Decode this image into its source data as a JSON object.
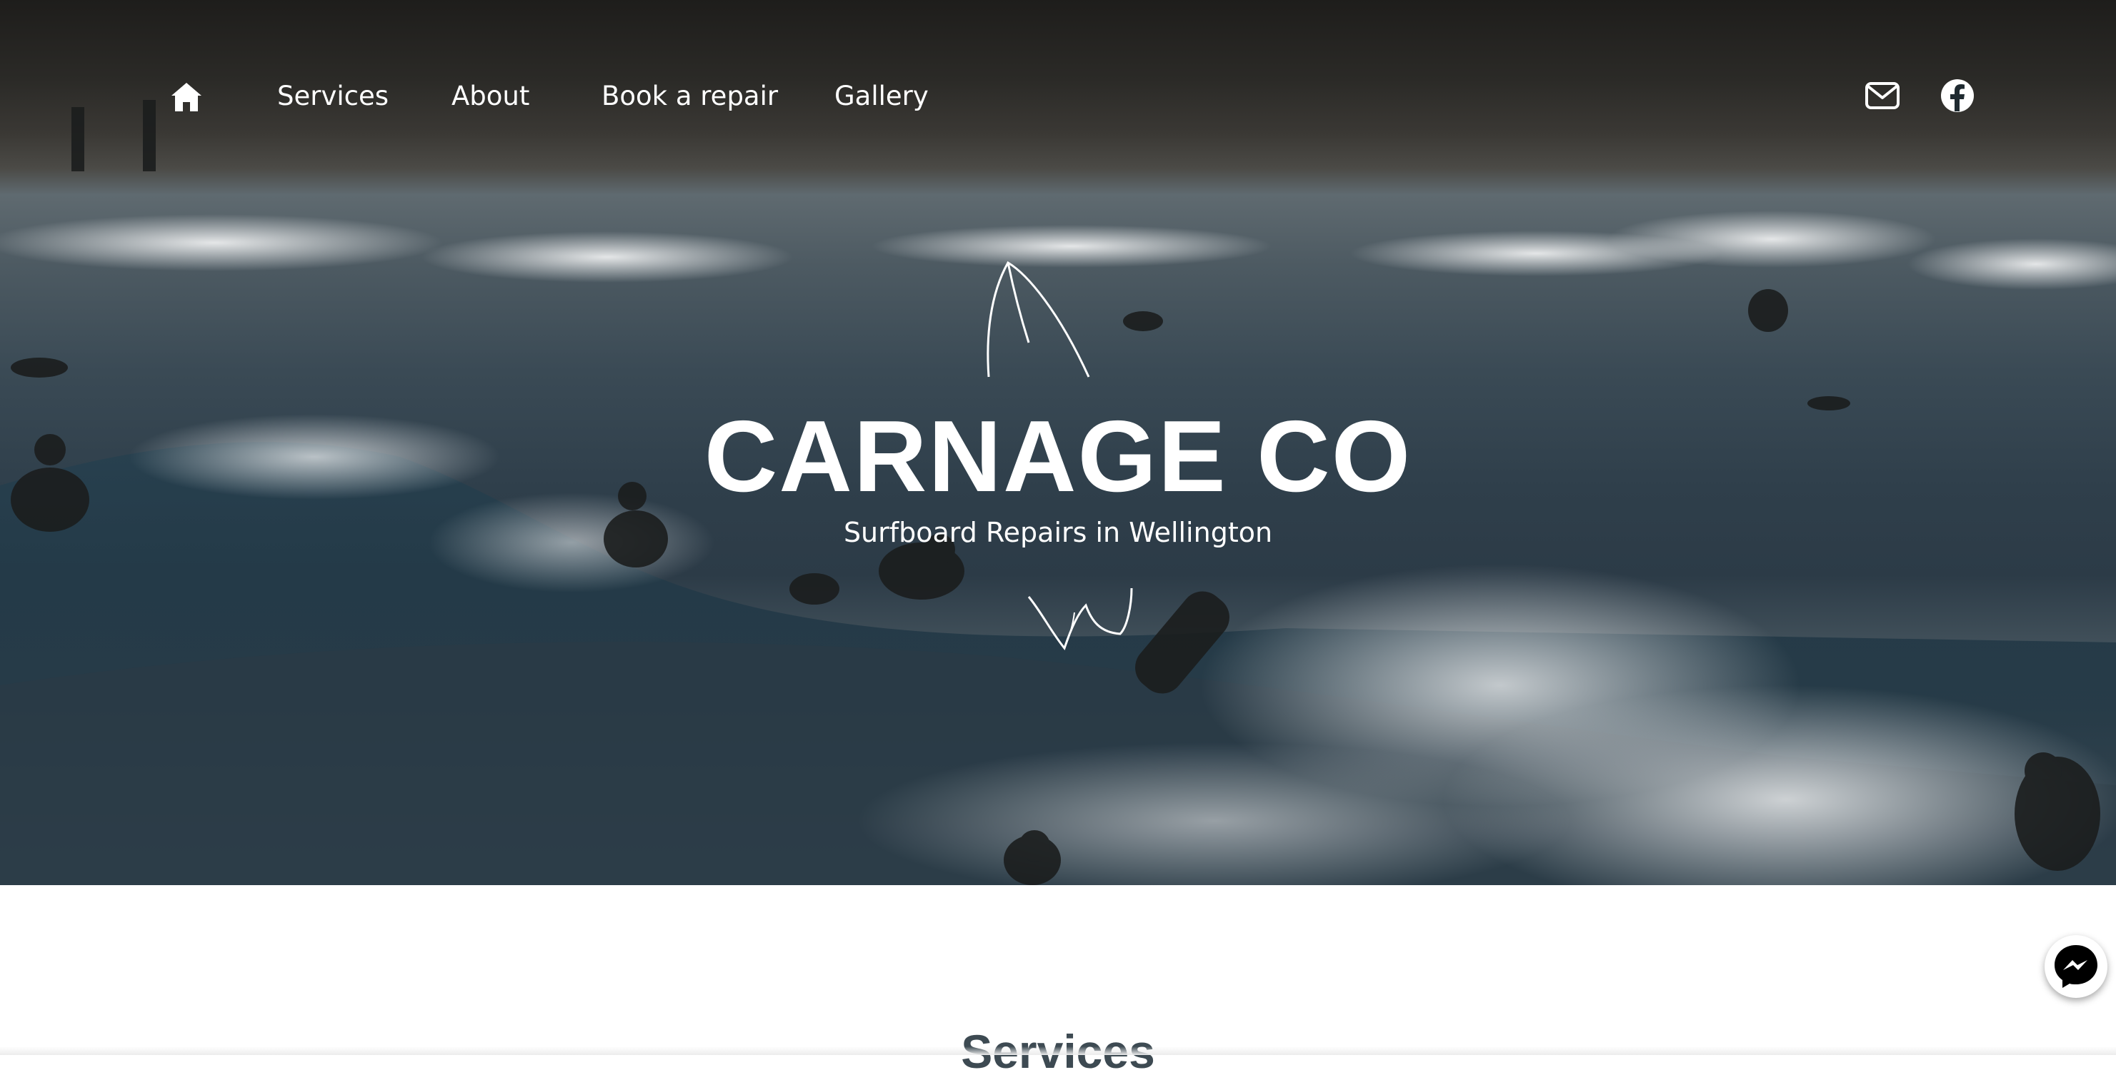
{
  "nav": {
    "home_icon": "home-icon",
    "links": [
      {
        "label": "Services"
      },
      {
        "label": "About"
      },
      {
        "label": "Book a repair"
      },
      {
        "label": "Gallery"
      }
    ],
    "social_icons": [
      "envelope-icon",
      "facebook-icon"
    ]
  },
  "hero": {
    "title": "CARNAGE CO",
    "tagline": "Surfboard Repairs in Wellington",
    "logo_icons": [
      "surfboard-fin-icon",
      "wave-splash-icon"
    ]
  },
  "main": {
    "section_title": "Services"
  },
  "chat": {
    "icon": "messenger-icon",
    "accent": "#000000"
  },
  "colors": {
    "heading_text": "#3d4a52",
    "hero_text": "#ffffff"
  }
}
